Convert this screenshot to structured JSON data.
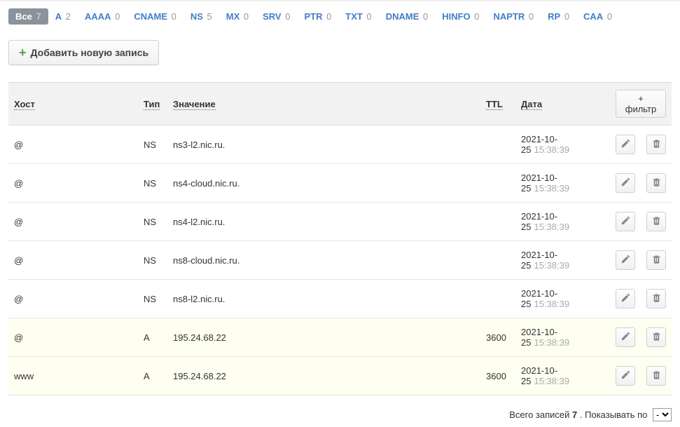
{
  "tabs": [
    {
      "label": "Все",
      "count": "7",
      "active": true
    },
    {
      "label": "A",
      "count": "2",
      "active": false
    },
    {
      "label": "AAAA",
      "count": "0",
      "active": false
    },
    {
      "label": "CNAME",
      "count": "0",
      "active": false
    },
    {
      "label": "NS",
      "count": "5",
      "active": false
    },
    {
      "label": "MX",
      "count": "0",
      "active": false
    },
    {
      "label": "SRV",
      "count": "0",
      "active": false
    },
    {
      "label": "PTR",
      "count": "0",
      "active": false
    },
    {
      "label": "TXT",
      "count": "0",
      "active": false
    },
    {
      "label": "DNAME",
      "count": "0",
      "active": false
    },
    {
      "label": "HINFO",
      "count": "0",
      "active": false
    },
    {
      "label": "NAPTR",
      "count": "0",
      "active": false
    },
    {
      "label": "RP",
      "count": "0",
      "active": false
    },
    {
      "label": "CAA",
      "count": "0",
      "active": false
    }
  ],
  "add_button": "Добавить новую запись",
  "headers": {
    "host": "Хост",
    "type": "Тип",
    "value": "Значение",
    "ttl": "TTL",
    "date": "Дата",
    "filter": "+ фильтр"
  },
  "rows": [
    {
      "host": "@",
      "type": "NS",
      "value": "ns3-l2.nic.ru.",
      "ttl": "",
      "date": "2021-10-25",
      "time": "15:38:39",
      "hl": false
    },
    {
      "host": "@",
      "type": "NS",
      "value": "ns4-cloud.nic.ru.",
      "ttl": "",
      "date": "2021-10-25",
      "time": "15:38:39",
      "hl": false
    },
    {
      "host": "@",
      "type": "NS",
      "value": "ns4-l2.nic.ru.",
      "ttl": "",
      "date": "2021-10-25",
      "time": "15:38:39",
      "hl": false
    },
    {
      "host": "@",
      "type": "NS",
      "value": "ns8-cloud.nic.ru.",
      "ttl": "",
      "date": "2021-10-25",
      "time": "15:38:39",
      "hl": false
    },
    {
      "host": "@",
      "type": "NS",
      "value": "ns8-l2.nic.ru.",
      "ttl": "",
      "date": "2021-10-25",
      "time": "15:38:39",
      "hl": false
    },
    {
      "host": "@",
      "type": "A",
      "value": "195.24.68.22",
      "ttl": "3600",
      "date": "2021-10-25",
      "time": "15:38:39",
      "hl": true
    },
    {
      "host": "www",
      "type": "A",
      "value": "195.24.68.22",
      "ttl": "3600",
      "date": "2021-10-25",
      "time": "15:38:39",
      "hl": true
    }
  ],
  "footer": {
    "total_label": "Всего записей",
    "total_count": "7",
    "show_label": ". Показывать по",
    "select_value": "-"
  }
}
